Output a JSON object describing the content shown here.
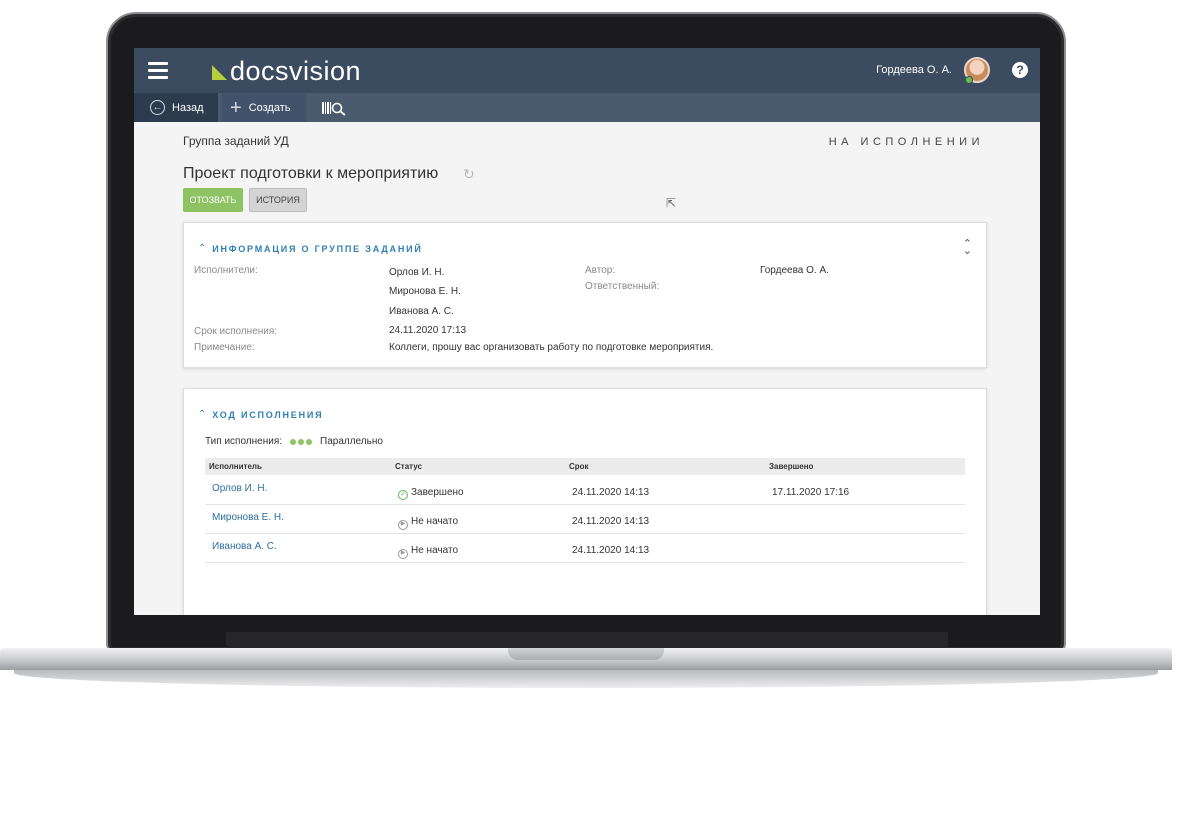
{
  "header": {
    "logo_text": "docsvision",
    "user_name": "Гордеева О. А.",
    "help_label": "?"
  },
  "toolbar": {
    "back_label": "Назад",
    "create_label": "Создать"
  },
  "page": {
    "breadcrumb": "Группа заданий УД",
    "state": "НА ИСПОЛНЕНИИ",
    "title": "Проект подготовки к мероприятию",
    "recall_button": "ОТОЗВАТЬ",
    "history_button": "ИСТОРИЯ"
  },
  "info": {
    "heading": "ИНФОРМАЦИЯ О ГРУППЕ ЗАДАНИЙ",
    "performers_label": "Исполнители:",
    "performers": [
      "Орлов И. Н.",
      "Миронова Е. Н.",
      "Иванова А. С."
    ],
    "author_label": "Автор:",
    "author": "Гордеева О. А.",
    "responsible_label": "Ответственный:",
    "deadline_label": "Срок исполнения:",
    "deadline": "24.11.2020 17:13",
    "note_label": "Примечание:",
    "note": "Коллеги, прошу вас организовать работу по подготовке мероприятия."
  },
  "progress": {
    "heading": "ХОД ИСПОЛНЕНИЯ",
    "exec_type_label": "Тип исполнения:",
    "exec_type": "Параллельно",
    "columns": [
      "Исполнитель",
      "Статус",
      "Срок",
      "Завершено"
    ],
    "rows": [
      {
        "performer": "Орлов И. Н.",
        "status": "Завершено",
        "status_kind": "done",
        "deadline": "24.11.2020 14:13",
        "completed": "17.11.2020 17:16"
      },
      {
        "performer": "Миронова Е. Н.",
        "status": "Не начато",
        "status_kind": "pending",
        "deadline": "24.11.2020 14:13",
        "completed": ""
      },
      {
        "performer": "Иванова А. С.",
        "status": "Не начато",
        "status_kind": "pending",
        "deadline": "24.11.2020 14:13",
        "completed": ""
      }
    ]
  },
  "colors": {
    "header_bg": "#3b4c61",
    "accent_blue": "#2f7fb4",
    "recall_green": "#8dc363",
    "logo_green": "#b7cf3a"
  },
  "icons": {
    "menu": "hamburger-icon",
    "back": "arrow-left-circle-icon",
    "create": "plus-icon",
    "search": "barcode-search-icon",
    "refresh": "refresh-icon",
    "done": "check-circle-icon",
    "pending": "play-circle-icon",
    "parallel": "parallel-execution-icon"
  }
}
